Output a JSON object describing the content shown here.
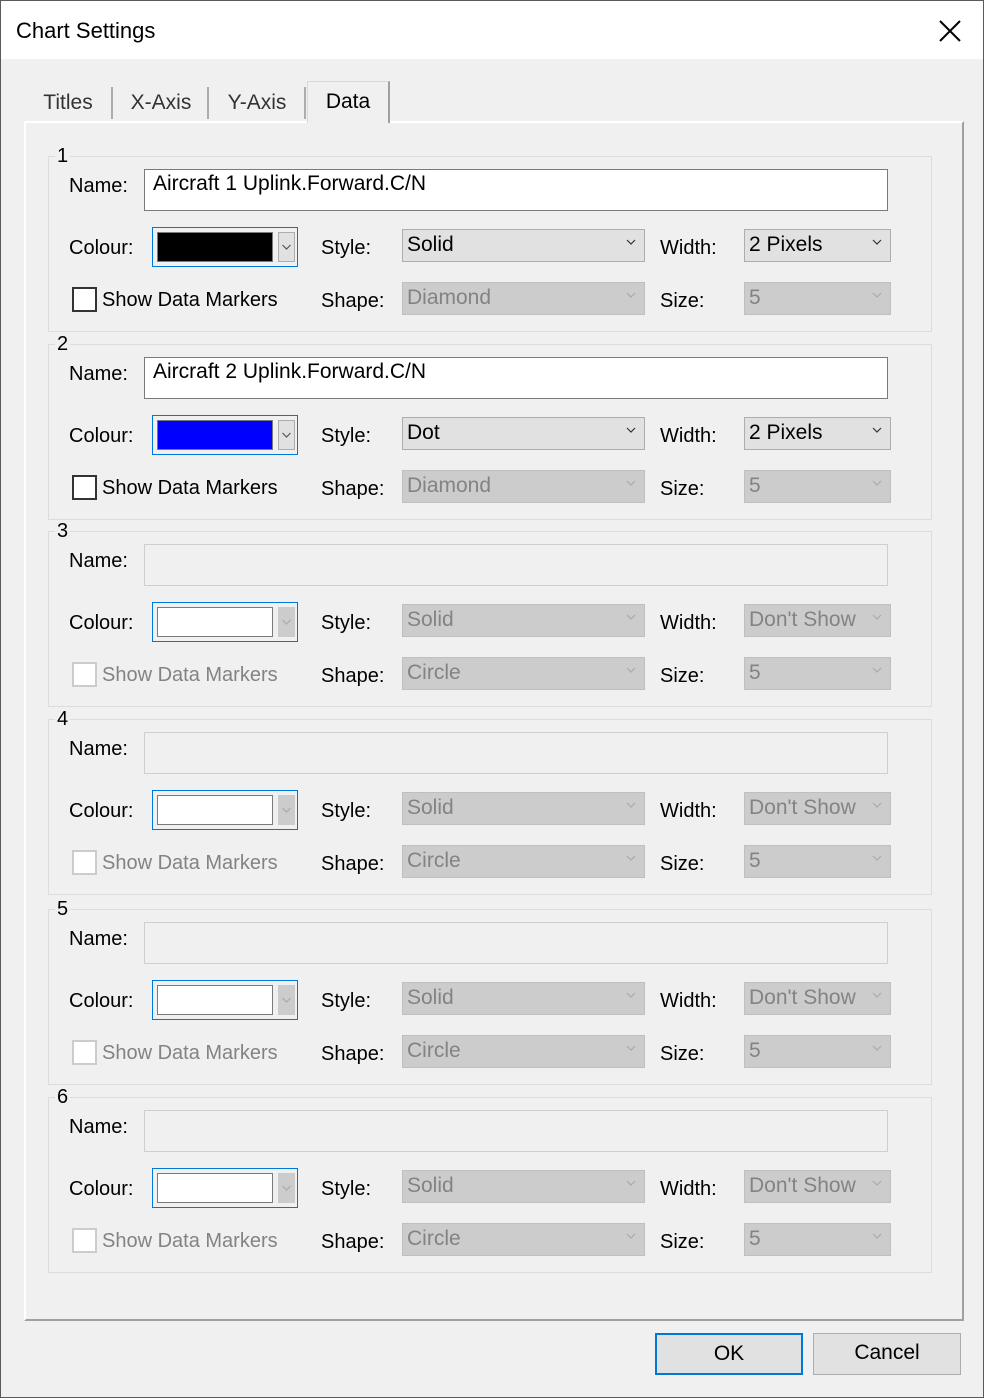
{
  "window": {
    "title": "Chart Settings",
    "close_icon": "close-icon"
  },
  "tabs": [
    {
      "label": "Titles",
      "active": false
    },
    {
      "label": "X-Axis",
      "active": false
    },
    {
      "label": "Y-Axis",
      "active": false
    },
    {
      "label": "Data",
      "active": true
    }
  ],
  "labels": {
    "name": "Name:",
    "colour": "Colour:",
    "style": "Style:",
    "width": "Width:",
    "show_markers": "Show Data Markers",
    "shape": "Shape:",
    "size": "Size:"
  },
  "series": [
    {
      "number": "1",
      "name": "Aircraft 1 Uplink.Forward.C/N",
      "enabled": true,
      "colour": "#000000",
      "style": "Solid",
      "width": "2 Pixels",
      "show_markers": false,
      "shape": "Diamond",
      "size": "5"
    },
    {
      "number": "2",
      "name": "Aircraft 2 Uplink.Forward.C/N",
      "enabled": true,
      "colour": "#0000ff",
      "style": "Dot",
      "width": "2 Pixels",
      "show_markers": false,
      "shape": "Diamond",
      "size": "5"
    },
    {
      "number": "3",
      "name": "",
      "enabled": false,
      "colour": "#ffffff",
      "style": "Solid",
      "width": "Don't Show",
      "show_markers": false,
      "shape": "Circle",
      "size": "5"
    },
    {
      "number": "4",
      "name": "",
      "enabled": false,
      "colour": "#ffffff",
      "style": "Solid",
      "width": "Don't Show",
      "show_markers": false,
      "shape": "Circle",
      "size": "5"
    },
    {
      "number": "5",
      "name": "",
      "enabled": false,
      "colour": "#ffffff",
      "style": "Solid",
      "width": "Don't Show",
      "show_markers": false,
      "shape": "Circle",
      "size": "5"
    },
    {
      "number": "6",
      "name": "",
      "enabled": false,
      "colour": "#ffffff",
      "style": "Solid",
      "width": "Don't Show",
      "show_markers": false,
      "shape": "Circle",
      "size": "5"
    }
  ],
  "buttons": {
    "ok": "OK",
    "cancel": "Cancel"
  },
  "colors": {
    "accent": "#0078d7"
  }
}
